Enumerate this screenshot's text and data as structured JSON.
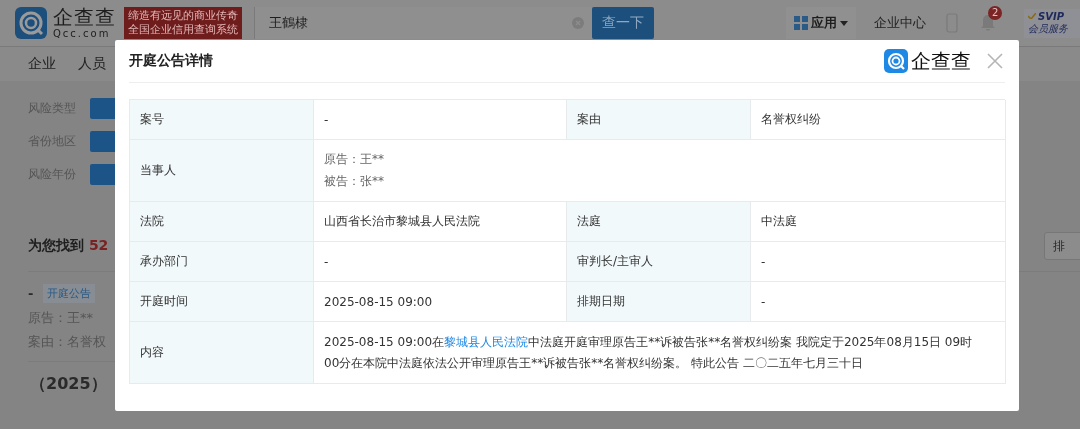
{
  "header": {
    "logo": "企查查",
    "logo_sub": "Qcc.com",
    "slogan": [
      "缔造有远见的商业传奇",
      "全国企业信用查询系统"
    ],
    "search": {
      "value": "王鶴棣"
    },
    "search_button": "查一下",
    "apps_menu": "应用",
    "enterprise_center": "企业中心",
    "notification_count": "2",
    "vip": {
      "label": "SVIP",
      "sub": "会员服务"
    }
  },
  "nav": [
    "企业",
    "人员"
  ],
  "filters": [
    {
      "label": "风险类型"
    },
    {
      "label": "省份地区"
    },
    {
      "label": "风险年份"
    }
  ],
  "results": {
    "prefix": "为您找到",
    "count": "52",
    "sort_button": "排"
  },
  "result_item": {
    "marker": "-",
    "tag": "开庭公告",
    "lines": [
      "原告：王**",
      "案由：名誉权"
    ]
  },
  "next_result_title": "（2025）",
  "modal": {
    "title": "开庭公告详情",
    "brand": "企查查",
    "rows": [
      {
        "kind": "pair",
        "fields": [
          {
            "label": "案号",
            "value": "-"
          },
          {
            "label": "案由",
            "value": "名誉权纠纷"
          }
        ]
      },
      {
        "kind": "lines",
        "label": "当事人",
        "lines": [
          "原告：王**",
          "被告：张**"
        ]
      },
      {
        "kind": "pair",
        "fields": [
          {
            "label": "法院",
            "value": "山西省长治市黎城县人民法院"
          },
          {
            "label": "法庭",
            "value": "中法庭"
          }
        ]
      },
      {
        "kind": "pair",
        "fields": [
          {
            "label": "承办部门",
            "value": "-"
          },
          {
            "label": "审判长/主审人",
            "value": "-"
          }
        ]
      },
      {
        "kind": "pair",
        "fields": [
          {
            "label": "开庭时间",
            "value": "2025-08-15 09:00"
          },
          {
            "label": "排期日期",
            "value": "-"
          }
        ]
      },
      {
        "kind": "content",
        "label": "内容",
        "before": "2025-08-15 09:00在",
        "link": "黎城县人民法院",
        "after": "中法庭开庭审理原告王**诉被告张**名誉权纠纷案 我院定于2025年08月15日 09时00分在本院中法庭依法公开审理原告王**诉被告张**名誉权纠纷案。 特此公告 二〇二五年七月三十日"
      }
    ]
  }
}
